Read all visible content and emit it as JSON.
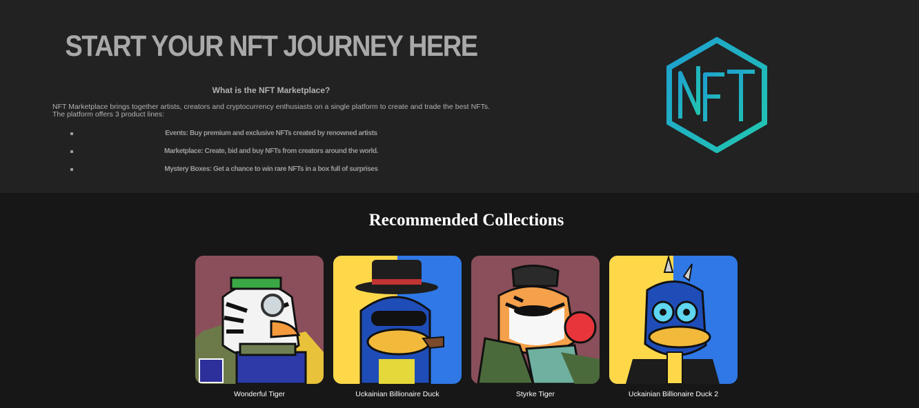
{
  "hero": {
    "title": "START YOUR NFT JOURNEY HERE",
    "subtitle": "What is the NFT Marketplace?",
    "description": "NFT Marketplace brings together artists, creators and cryptocurrency enthusiasts on a single platform to create and trade the best NFTs. The platform offers 3 product lines:",
    "product_lines": [
      "Events: Buy premium and exclusive NFTs created by renowned artists",
      "Marketplace: Create, bid and buy NFTs from creators around the world.",
      "Mystery Boxes: Get a chance to win rare NFTs in a box full of surprises"
    ],
    "logo_text": "NFT"
  },
  "recommended": {
    "title": "Recommended Collections",
    "items": [
      {
        "name": "Wonderful Tiger",
        "bg": "#8a4f5a",
        "kind": "tiger"
      },
      {
        "name": "Uckainian Billionaire Duck",
        "bg": "#2f78e6",
        "kind": "duck"
      },
      {
        "name": "Styrke Tiger",
        "bg": "#8a4f5a",
        "kind": "tiger"
      },
      {
        "name": "Uckainian Billionaire Duck 2",
        "bg": "#2f78e6",
        "kind": "duck"
      }
    ]
  },
  "colors": {
    "accent": "#1fb3c8",
    "hero_bg": "#222222",
    "page_bg": "#171717",
    "yellow": "#ffd84a"
  }
}
